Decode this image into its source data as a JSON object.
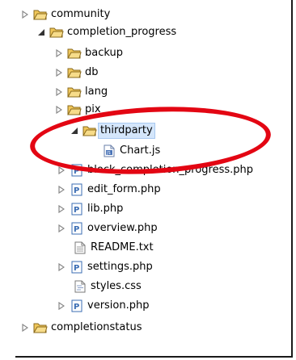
{
  "tree": {
    "items": [
      {
        "label": "community",
        "type": "folder",
        "expanded": false
      },
      {
        "label": "completion_progress",
        "type": "folder",
        "expanded": true
      },
      {
        "label": "backup",
        "type": "folder",
        "expanded": false
      },
      {
        "label": "db",
        "type": "folder",
        "expanded": false
      },
      {
        "label": "lang",
        "type": "folder",
        "expanded": false
      },
      {
        "label": "pix",
        "type": "folder",
        "expanded": false
      },
      {
        "label": "thirdparty",
        "type": "folder",
        "expanded": true
      },
      {
        "label": "Chart.js",
        "type": "js-file"
      },
      {
        "label": "block_completion_progress.php",
        "type": "php-file"
      },
      {
        "label": "edit_form.php",
        "type": "php-file"
      },
      {
        "label": "lib.php",
        "type": "php-file"
      },
      {
        "label": "overview.php",
        "type": "php-file"
      },
      {
        "label": "README.txt",
        "type": "text-file"
      },
      {
        "label": "settings.php",
        "type": "php-file"
      },
      {
        "label": "styles.css",
        "type": "css-file"
      },
      {
        "label": "version.php",
        "type": "php-file"
      },
      {
        "label": "completionstatus",
        "type": "folder",
        "expanded": false
      }
    ]
  },
  "colors": {
    "annotation_ellipse": "#e30613",
    "folder_fill": "#f0c75a",
    "php_icon": "#3b6db3"
  }
}
